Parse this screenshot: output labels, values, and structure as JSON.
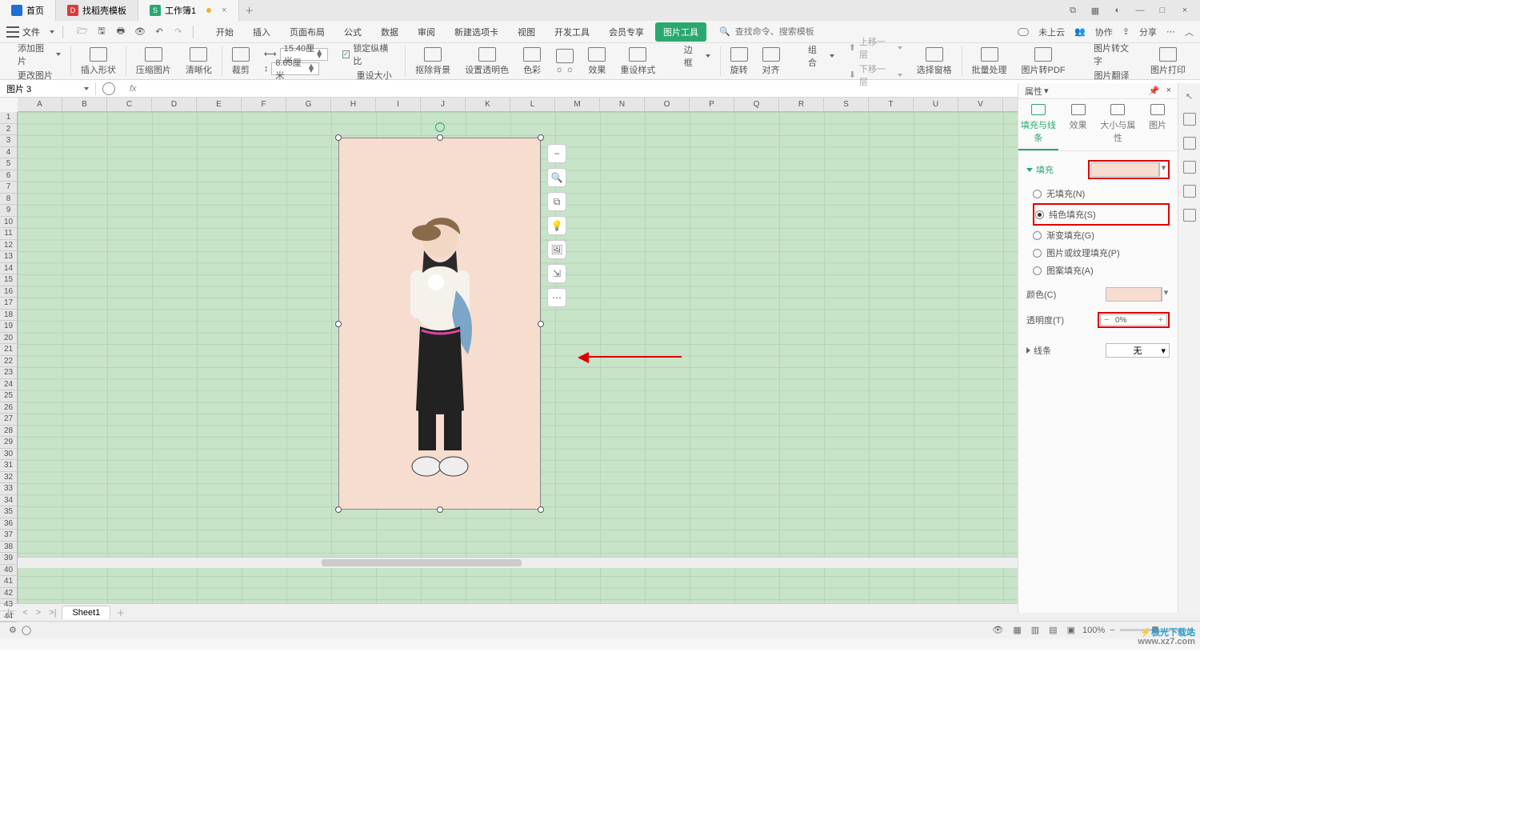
{
  "tabs": [
    {
      "label": "首页",
      "icon_color": "#1f6fd4"
    },
    {
      "label": "找稻壳模板",
      "icon_color": "#d93a3a"
    },
    {
      "label": "工作簿1",
      "icon_color": "#2aa86f",
      "unsaved": true
    }
  ],
  "file_menu": "文件",
  "ribbon_tabs": [
    "开始",
    "插入",
    "页面布局",
    "公式",
    "数据",
    "审阅",
    "新建选项卡",
    "视图",
    "开发工具",
    "会员专享",
    "图片工具"
  ],
  "search": {
    "hint": "查找命令、搜索模板"
  },
  "top_right": {
    "cloud": "未上云",
    "collab": "协作",
    "share": "分享"
  },
  "ribbon": {
    "add_image": "添加图片",
    "change_image": "更改图片",
    "insert_shape": "插入形状",
    "compress": "压缩图片",
    "clarity": "清晰化",
    "crop": "裁剪",
    "width": "15.40厘米",
    "height": "8.63厘米",
    "lock_ratio": "锁定纵横比",
    "reset_size": "重设大小",
    "remove_bg": "抠除背景",
    "set_transparent": "设置透明色",
    "color": "色彩",
    "lumi": "亮度",
    "effect": "效果",
    "reset_style": "重设样式",
    "border": "边框",
    "rotate": "旋转",
    "align": "对齐",
    "group": "组合",
    "up_layer": "上移一层",
    "down_layer": "下移一层",
    "sel_pane": "选择窗格",
    "batch": "批量处理",
    "to_pdf": "图片转PDF",
    "to_text": "图片转文字",
    "translate": "图片翻译",
    "print": "图片打印"
  },
  "namebox": "图片 3",
  "columns": [
    "A",
    "B",
    "C",
    "D",
    "E",
    "F",
    "G",
    "H",
    "I",
    "J",
    "K",
    "L",
    "M",
    "N",
    "O",
    "P",
    "Q",
    "R",
    "S",
    "T",
    "U",
    "V"
  ],
  "float_tools": [
    "zoom-out-icon",
    "zoom-fit-icon",
    "crop-icon",
    "idea-icon",
    "replace-icon",
    "export-icon",
    "more-icon"
  ],
  "right_panel": {
    "title": "属性",
    "tabs": [
      "填充与线条",
      "效果",
      "大小与属性",
      "图片"
    ],
    "fill_section": "填充",
    "fill_options": {
      "none": "无填充(N)",
      "solid": "纯色填充(S)",
      "gradient": "渐变填充(G)",
      "picture": "图片或纹理填充(P)",
      "pattern": "图案填充(A)"
    },
    "color_label": "颜色(C)",
    "opacity_label": "透明度(T)",
    "opacity_value": "0%",
    "line_section": "线条",
    "line_value": "无"
  },
  "sheet": {
    "name": "Sheet1"
  },
  "status": {
    "zoom": "100%"
  },
  "watermark": {
    "l1": "极光下载站",
    "l2": "www.xz7.com"
  }
}
